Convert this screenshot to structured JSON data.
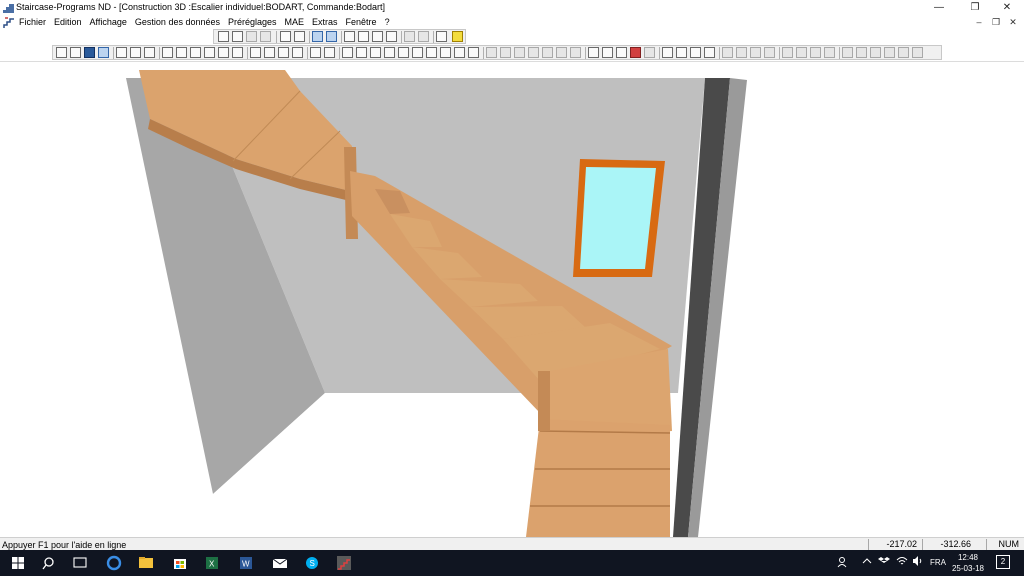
{
  "window": {
    "title": "Staircase-Programs ND   - [Construction 3D :Escalier individuel:BODART, Commande:Bodart]",
    "minimize_glyph": "—",
    "maximize_glyph": "❐",
    "close_glyph": "✕"
  },
  "menubar": {
    "items": [
      "Fichier",
      "Edition",
      "Affichage",
      "Gestion des données",
      "Préréglages",
      "MAE",
      "Extras",
      "Fenêtre",
      "?"
    ],
    "child_minimize_glyph": "–",
    "child_restore_glyph": "❐",
    "child_close_glyph": "✕"
  },
  "colors": {
    "wood": "#d9a26d",
    "wood_dark": "#b87e4b",
    "wall": "#b9b9b9",
    "wall_dark": "#8f8f8f",
    "window_frame": "#d86a12",
    "window_glass": "#aaf5f7",
    "taskbar": "#101521"
  },
  "statusbar": {
    "help_text": "Appuyer F1 pour l'aide en ligne",
    "coord_x": "-217.02",
    "coord_y": "-312.66",
    "num": "NUM"
  },
  "taskbar": {
    "icons": [
      "windows-start-icon",
      "search-icon",
      "task-view-icon",
      "edge-icon",
      "file-explorer-icon",
      "store-icon",
      "excel-icon",
      "word-icon",
      "mail-icon",
      "skype-icon",
      "staircase-app-icon"
    ],
    "tray_icons": [
      "people-icon",
      "chevron-up-icon",
      "dropbox-icon",
      "network-icon",
      "volume-icon"
    ],
    "language": "FRA",
    "time": "12:48",
    "date": "25-03-18",
    "notification_count": "2"
  }
}
